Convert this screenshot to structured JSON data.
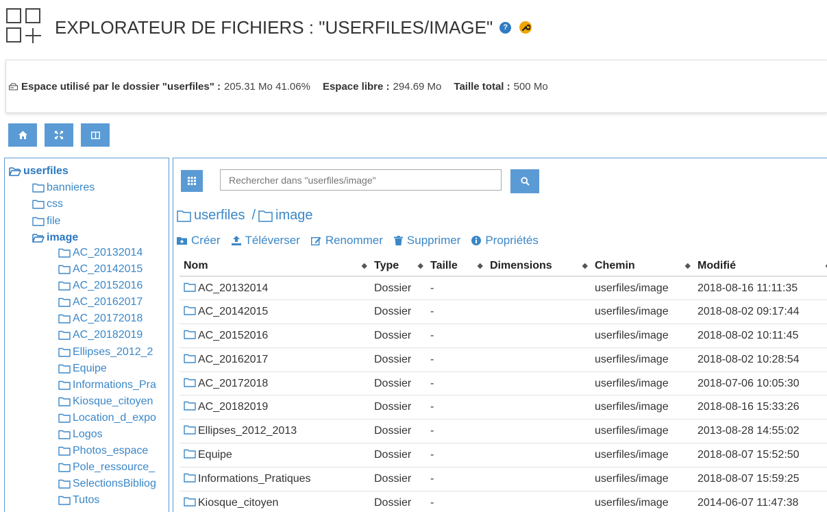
{
  "header": {
    "title": "EXPLORATEUR DE FICHIERS : \"USERFILES/IMAGE\"",
    "help_icon_glyph": "?"
  },
  "usage": {
    "used_label": "Espace utilisé par le dossier \"userfiles\" :",
    "used_value": "205.31 Mo 41.06%",
    "free_label": "Espace libre :",
    "free_value": "294.69 Mo",
    "total_label": "Taille total :",
    "total_value": "500 Mo"
  },
  "tree": {
    "root": "userfiles",
    "items": [
      "bannieres",
      "css",
      "file"
    ],
    "current": "image",
    "children": [
      "AC_20132014",
      "AC_20142015",
      "AC_20152016",
      "AC_20162017",
      "AC_20172018",
      "AC_20182019",
      "Ellipses_2012_2",
      "Equipe",
      "Informations_Pra",
      "Kiosque_citoyen",
      "Location_d_expo",
      "Logos",
      "Photos_espace",
      "Pole_ressource_",
      "SelectionsBibliog",
      "Tutos"
    ]
  },
  "search": {
    "placeholder": "Rechercher dans \"userfiles/image\""
  },
  "breadcrumb": {
    "root": "userfiles",
    "current": "image",
    "separator": "/"
  },
  "actions": {
    "create": "Créer",
    "upload": "Téléverser",
    "rename": "Renommer",
    "delete": "Supprimer",
    "properties": "Propriétés"
  },
  "table": {
    "headers": {
      "name": "Nom",
      "type": "Type",
      "size": "Taille",
      "dimensions": "Dimensions",
      "path": "Chemin",
      "modified": "Modifié"
    },
    "rows": [
      {
        "name": "AC_20132014",
        "type": "Dossier",
        "size": "-",
        "dimensions": "",
        "path": "userfiles/image",
        "modified": "2018-08-16 11:11:35"
      },
      {
        "name": "AC_20142015",
        "type": "Dossier",
        "size": "-",
        "dimensions": "",
        "path": "userfiles/image",
        "modified": "2018-08-02 09:17:44"
      },
      {
        "name": "AC_20152016",
        "type": "Dossier",
        "size": "-",
        "dimensions": "",
        "path": "userfiles/image",
        "modified": "2018-08-02 10:11:45"
      },
      {
        "name": "AC_20162017",
        "type": "Dossier",
        "size": "-",
        "dimensions": "",
        "path": "userfiles/image",
        "modified": "2018-08-02 10:28:54"
      },
      {
        "name": "AC_20172018",
        "type": "Dossier",
        "size": "-",
        "dimensions": "",
        "path": "userfiles/image",
        "modified": "2018-07-06 10:05:30"
      },
      {
        "name": "AC_20182019",
        "type": "Dossier",
        "size": "-",
        "dimensions": "",
        "path": "userfiles/image",
        "modified": "2018-08-16 15:33:26"
      },
      {
        "name": "Ellipses_2012_2013",
        "type": "Dossier",
        "size": "-",
        "dimensions": "",
        "path": "userfiles/image",
        "modified": "2013-08-28 14:55:02"
      },
      {
        "name": "Equipe",
        "type": "Dossier",
        "size": "-",
        "dimensions": "",
        "path": "userfiles/image",
        "modified": "2018-08-07 15:52:50"
      },
      {
        "name": "Informations_Pratiques",
        "type": "Dossier",
        "size": "-",
        "dimensions": "",
        "path": "userfiles/image",
        "modified": "2018-08-07 15:59:25"
      },
      {
        "name": "Kiosque_citoyen",
        "type": "Dossier",
        "size": "-",
        "dimensions": "",
        "path": "userfiles/image",
        "modified": "2014-06-07 11:47:38"
      }
    ]
  },
  "colors": {
    "accent": "#5b9bd5",
    "link": "#3a87c8",
    "warning": "#f0a500"
  }
}
